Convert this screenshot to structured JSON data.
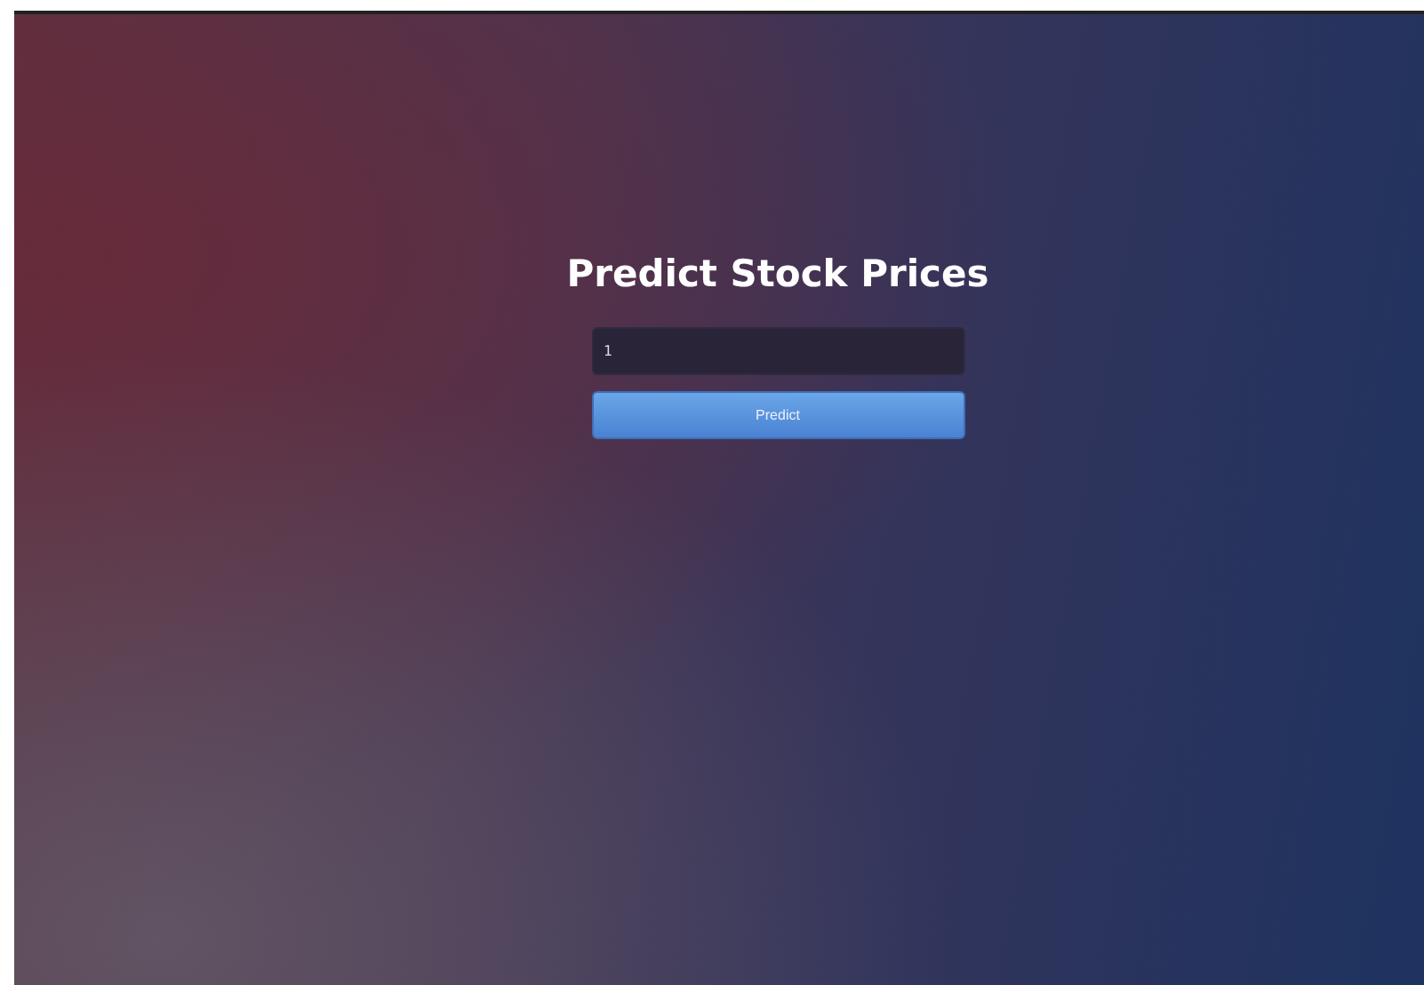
{
  "title": "Predict Stock Prices",
  "input": {
    "value": "1"
  },
  "button": {
    "label": "Predict"
  }
}
